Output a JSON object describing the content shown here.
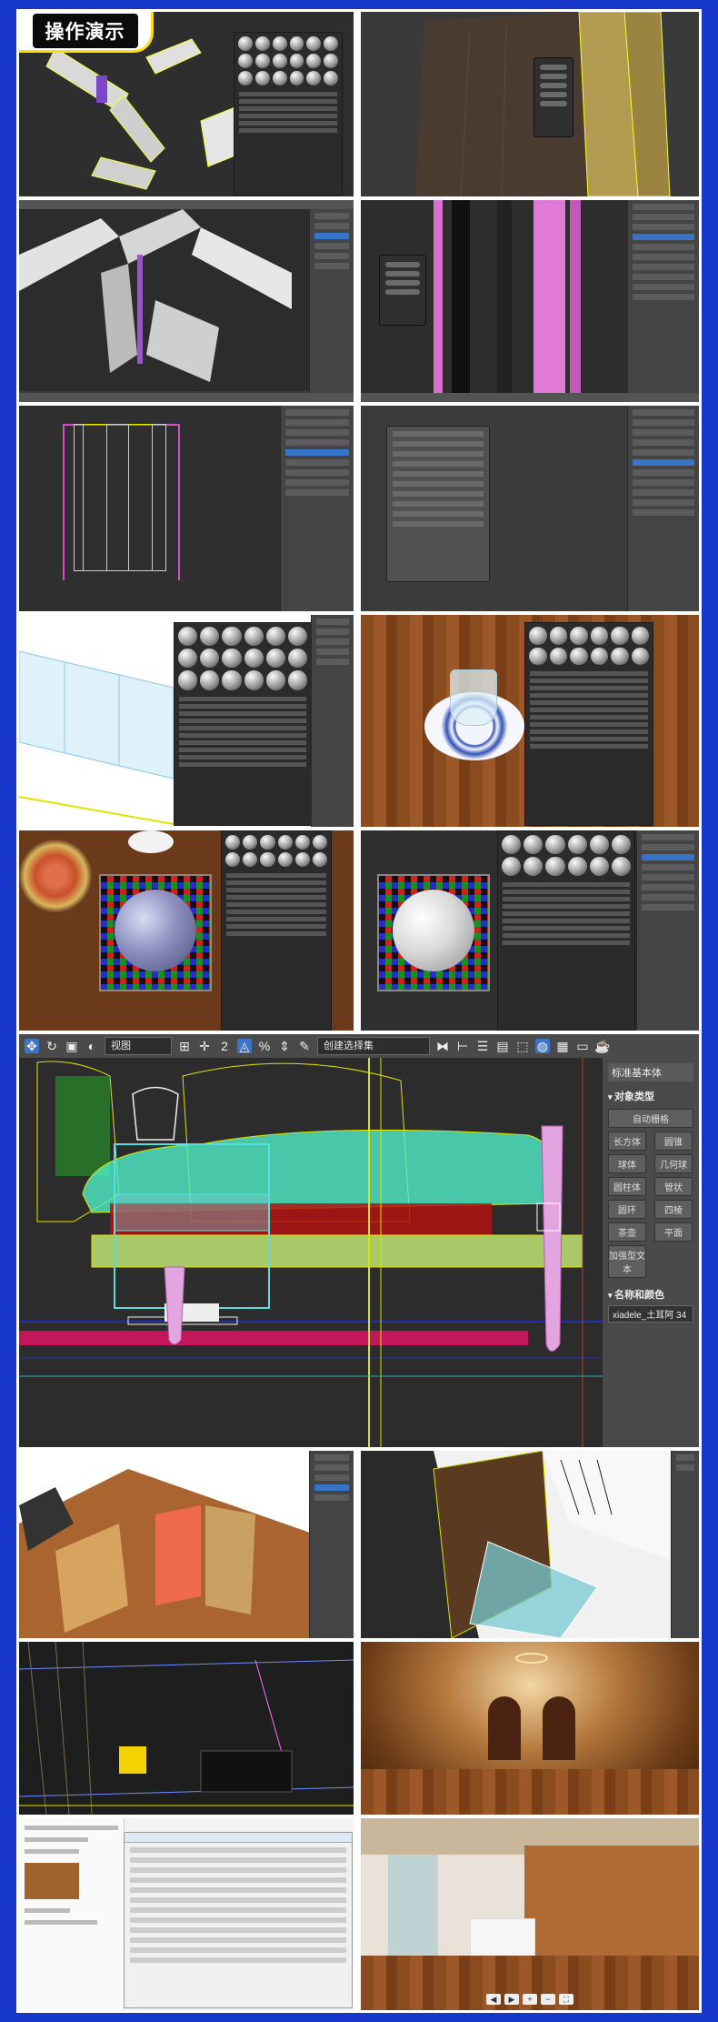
{
  "banner": {
    "title": "操作演示"
  },
  "big_panel": {
    "toolbar": {
      "view_dropdown": "视图",
      "selection_set_dropdown": "创建选择集",
      "number_label": "2"
    },
    "command_panel": {
      "header": "标准基本体",
      "object_type_section": "对象类型",
      "autogrid": "自动栅格",
      "buttons": [
        "长方体",
        "圆锥",
        "球体",
        "几何球",
        "圆柱体",
        "管状",
        "圆环",
        "四棱",
        "茶壶",
        "平面"
      ],
      "extra_button": "加强型文本",
      "name_color_section": "名称和颜色",
      "object_name": "xiadele_土耳阿 34"
    }
  },
  "colors": {
    "border": "#1637c9",
    "accent": "#ffde00",
    "wire": "#d7e500"
  }
}
